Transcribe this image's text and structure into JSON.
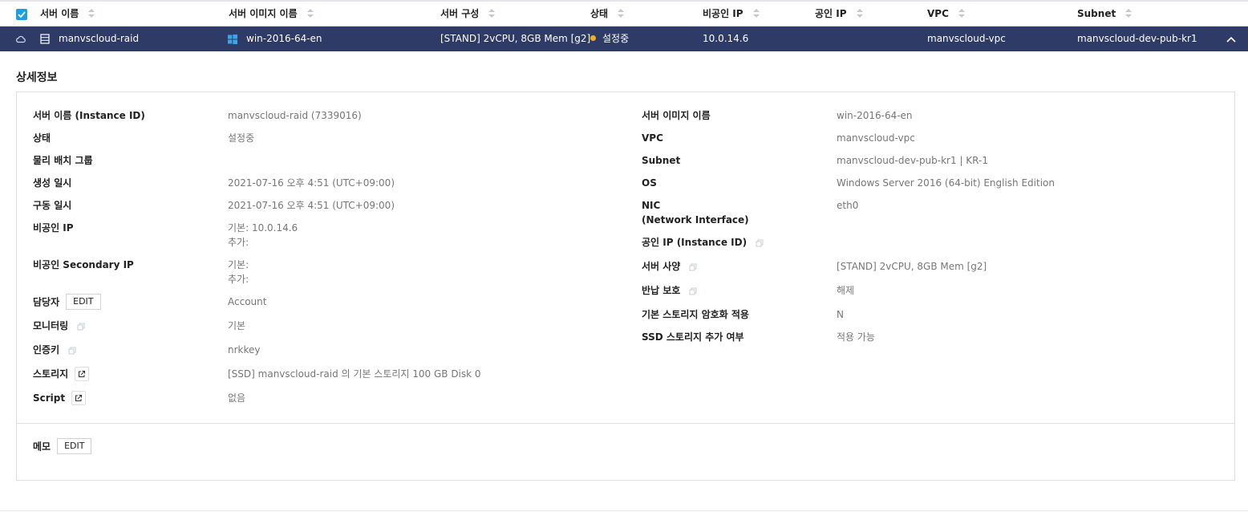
{
  "table": {
    "headers": [
      "서버 이름",
      "서버 이미지 이름",
      "서버 구성",
      "상태",
      "비공인 IP",
      "공인 IP",
      "VPC",
      "Subnet"
    ],
    "selected_row": {
      "server_name": "manvscloud-raid",
      "image": "win-2016-64-en",
      "spec": "[STAND] 2vCPU, 8GB Mem [g2]",
      "status": "설정중",
      "private_ip": "10.0.14.6",
      "public_ip": "",
      "vpc": "manvscloud-vpc",
      "subnet": "manvscloud-dev-pub-kr1"
    }
  },
  "detail": {
    "title": "상세정보",
    "left": [
      {
        "label": "서버 이름 (Instance ID)",
        "value": "manvscloud-raid (7339016)"
      },
      {
        "label": "상태",
        "value": "설정중"
      },
      {
        "label": "물리 배치 그룹",
        "value": ""
      },
      {
        "label": "생성 일시",
        "value": "2021-07-16 오후 4:51 (UTC+09:00)"
      },
      {
        "label": "구동 일시",
        "value": "2021-07-16 오후 4:51 (UTC+09:00)"
      },
      {
        "label": "비공인 IP",
        "value": "기본: 10.0.14.6",
        "value2": "추가:"
      },
      {
        "label": "비공인 Secondary IP",
        "value": "기본:",
        "value2": "추가:"
      },
      {
        "label": "담당자",
        "button": "EDIT",
        "value": "Account"
      },
      {
        "label": "모니터링",
        "icon": "copy-icon",
        "value": "기본"
      },
      {
        "label": "인증키",
        "icon": "copy-icon",
        "value": "nrkkey"
      },
      {
        "label": "스토리지",
        "icon": "external-link-icon",
        "value": "[SSD] manvscloud-raid 의 기본 스토리지  100 GB Disk 0"
      },
      {
        "label": "Script",
        "icon": "external-link-icon",
        "value": "없음"
      }
    ],
    "right": [
      {
        "label": "서버 이미지 이름",
        "value": "win-2016-64-en"
      },
      {
        "label": "VPC",
        "value": "manvscloud-vpc"
      },
      {
        "label": "Subnet",
        "value": "manvscloud-dev-pub-kr1 | KR-1"
      },
      {
        "label": "OS",
        "value": "Windows Server 2016 (64-bit) English Edition"
      },
      {
        "label": "NIC",
        "label2": "(Network Interface)",
        "value": "eth0"
      },
      {
        "label": "공인 IP (Instance ID)",
        "icon": "copy-icon",
        "value": ""
      },
      {
        "label": "서버 사양",
        "icon": "copy-icon",
        "value": "[STAND] 2vCPU, 8GB Mem [g2]"
      },
      {
        "label": "반납 보호",
        "icon": "copy-icon",
        "value": "해제"
      },
      {
        "label": "기본 스토리지 암호화 적용",
        "value": "N"
      },
      {
        "label": "SSD 스토리지 추가 여부",
        "value": "적용 가능"
      }
    ],
    "memo": {
      "label": "메모",
      "button": "EDIT"
    }
  },
  "colors": {
    "row_selected": "#2e3b67",
    "accent": "#1a9fe0",
    "status_dot": "#f2b01e"
  }
}
